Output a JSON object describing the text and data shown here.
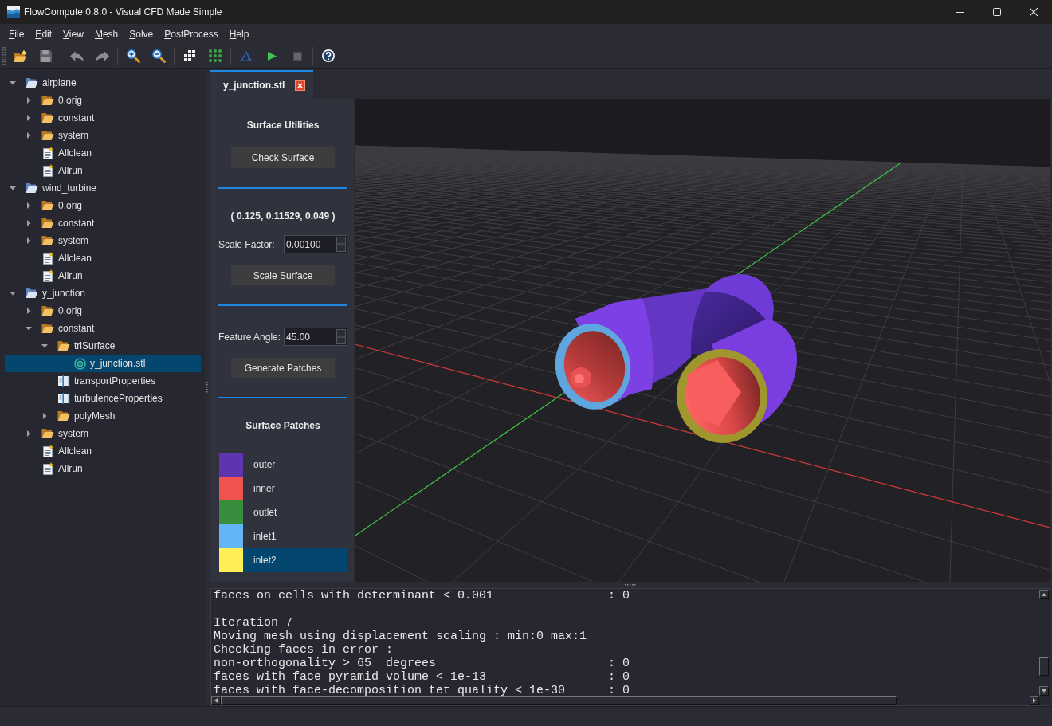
{
  "window": {
    "title": "FlowCompute 0.8.0 - Visual CFD Made Simple"
  },
  "menu_bar": [
    "File",
    "Edit",
    "View",
    "Mesh",
    "Solve",
    "PostProcess",
    "Help"
  ],
  "toolbar": [
    [
      {
        "kind": "open",
        "disabled": false
      },
      {
        "kind": "save",
        "disabled": true
      }
    ],
    [
      {
        "kind": "undo",
        "disabled": true
      },
      {
        "kind": "redo",
        "disabled": true
      }
    ],
    [
      {
        "kind": "zoomin",
        "disabled": false
      },
      {
        "kind": "zoomout",
        "disabled": false
      }
    ],
    [
      {
        "kind": "blocks",
        "disabled": false
      },
      {
        "kind": "points",
        "disabled": false
      }
    ],
    [
      {
        "kind": "solver",
        "disabled": false
      },
      {
        "kind": "run",
        "disabled": false
      },
      {
        "kind": "stop",
        "disabled": true
      }
    ],
    [
      {
        "kind": "help",
        "disabled": false
      }
    ]
  ],
  "tree": [
    {
      "label": "airplane",
      "kind": "project",
      "expanded": true,
      "selected": false,
      "children": [
        {
          "label": "0.orig",
          "kind": "folder",
          "expanded": false,
          "selected": false
        },
        {
          "label": "constant",
          "kind": "folder",
          "expanded": false,
          "selected": false
        },
        {
          "label": "system",
          "kind": "folder",
          "expanded": false,
          "selected": false
        },
        {
          "label": "Allclean",
          "kind": "script",
          "selected": false
        },
        {
          "label": "Allrun",
          "kind": "script",
          "selected": false
        }
      ]
    },
    {
      "label": "wind_turbine",
      "kind": "project",
      "expanded": true,
      "selected": false,
      "children": [
        {
          "label": "0.orig",
          "kind": "folder",
          "expanded": false,
          "selected": false
        },
        {
          "label": "constant",
          "kind": "folder",
          "expanded": false,
          "selected": false
        },
        {
          "label": "system",
          "kind": "folder",
          "expanded": false,
          "selected": false
        },
        {
          "label": "Allclean",
          "kind": "script",
          "selected": false
        },
        {
          "label": "Allrun",
          "kind": "script",
          "selected": false
        }
      ]
    },
    {
      "label": "y_junction",
      "kind": "project",
      "expanded": true,
      "selected": false,
      "children": [
        {
          "label": "0.orig",
          "kind": "folder",
          "expanded": false,
          "selected": false
        },
        {
          "label": "constant",
          "kind": "folder",
          "expanded": true,
          "selected": false,
          "children": [
            {
              "label": "triSurface",
              "kind": "folder",
              "expanded": true,
              "selected": false,
              "children": [
                {
                  "label": "y_junction.stl",
                  "kind": "surface",
                  "selected": true
                }
              ]
            },
            {
              "label": "transportProperties",
              "kind": "dictionary",
              "selected": false
            },
            {
              "label": "turbulenceProperties",
              "kind": "dictionary",
              "selected": false
            },
            {
              "label": "polyMesh",
              "kind": "folder",
              "expanded": false,
              "selected": false
            }
          ]
        },
        {
          "label": "system",
          "kind": "folder",
          "expanded": false,
          "selected": false
        },
        {
          "label": "Allclean",
          "kind": "script",
          "selected": false
        },
        {
          "label": "Allrun",
          "kind": "script",
          "selected": false
        }
      ]
    }
  ],
  "tabs": [
    {
      "label": "y_junction.stl",
      "selected": true
    }
  ],
  "surface_panel": {
    "title": "Surface Utilities",
    "check_button": "Check Surface",
    "bounds": "( 0.125, 0.11529, 0.049 )",
    "scale_factor": {
      "label": "Scale Factor:",
      "value": "0.00100"
    },
    "scale_button": "Scale Surface",
    "feature_angle": {
      "label": "Feature Angle:",
      "value": "45.00"
    },
    "generate_button": "Generate Patches",
    "patches_title": "Surface Patches",
    "patches": [
      {
        "name": "outer",
        "color": "#5e35b1",
        "selected": false
      },
      {
        "name": "inner",
        "color": "#ef5350",
        "selected": false
      },
      {
        "name": "outlet",
        "color": "#388e3c",
        "selected": false
      },
      {
        "name": "inlet1",
        "color": "#64b5f6",
        "selected": false
      },
      {
        "name": "inlet2",
        "color": "#ffee58",
        "selected": true
      }
    ]
  },
  "console": {
    "blocks": [
      [
        "faces on cells with determinant < 0.001                : 0"
      ],
      [
        "Iteration 7",
        "Moving mesh using displacement scaling : min:0 max:1",
        "Checking faces in error :",
        "non-orthogonality > 65  degrees                        : 0",
        "faces with face pyramid volume < 1e-13                 : 0",
        "faces with face-decomposition tet quality < 1e-30      : 0"
      ]
    ]
  }
}
